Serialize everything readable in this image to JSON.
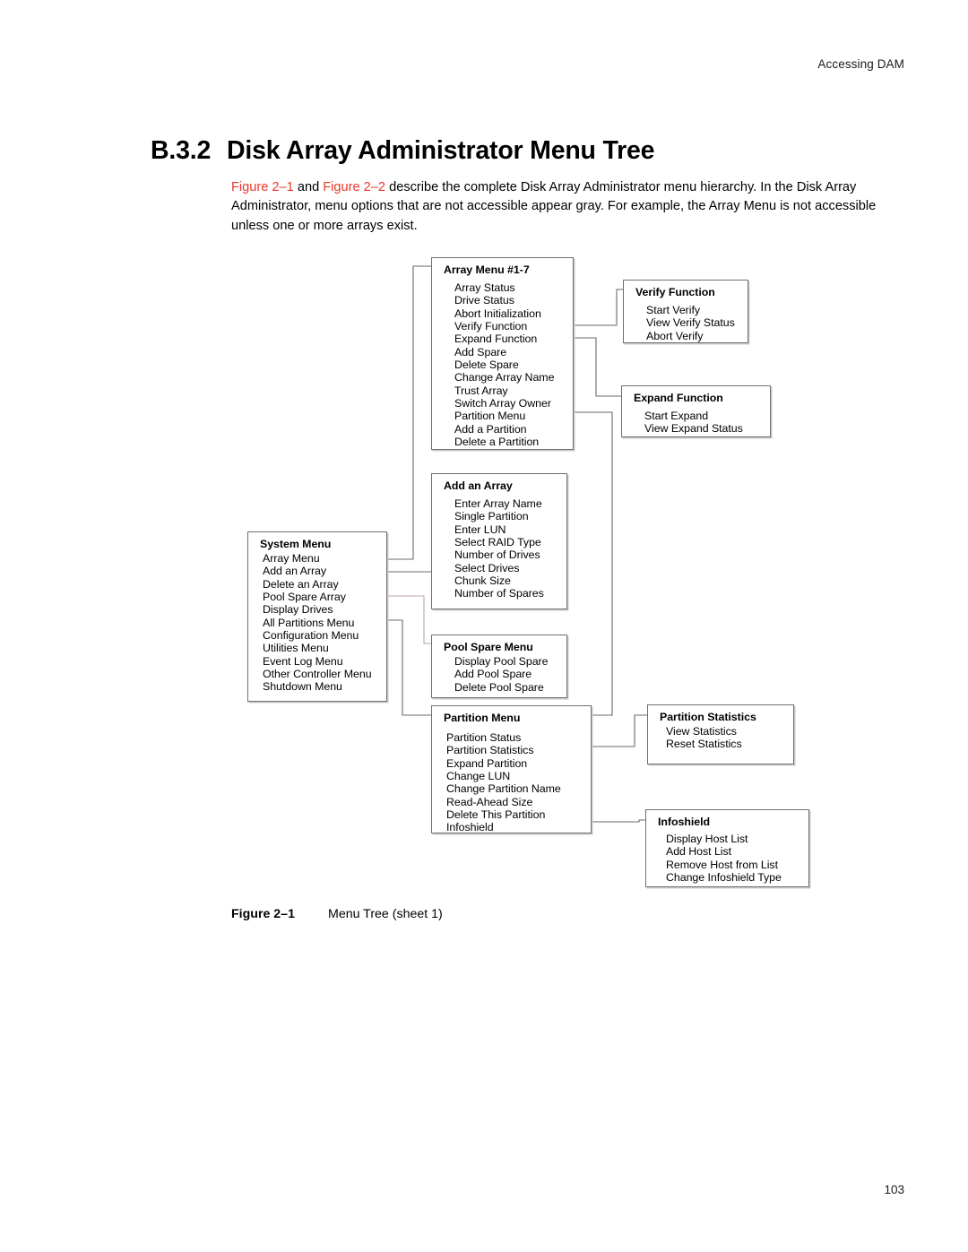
{
  "header": {
    "running_head": "Accessing DAM",
    "page_number": "103"
  },
  "section": {
    "number": "B.3.2",
    "title": "Disk Array Administrator Menu Tree"
  },
  "paragraph": {
    "xref1": "Figure 2–1",
    "mid1": " and ",
    "xref2": "Figure 2–2",
    "rest": " describe the complete Disk Array Administrator menu hierarchy. In the Disk Array Administrator, menu options that are not accessible appear gray. For example, the Array Menu is not accessible unless one or more arrays exist."
  },
  "figure": {
    "label": "Figure 2–1",
    "caption": "Menu Tree (sheet 1)"
  },
  "diagram": {
    "nodes": {
      "array_menu": {
        "title": "Array Menu #1-7",
        "items": [
          "Array Status",
          "Drive Status",
          "Abort Initialization",
          "Verify Function",
          "Expand Function",
          "Add Spare",
          "Delete Spare",
          "Change Array Name",
          "Trust Array",
          "Switch Array Owner",
          "Partition Menu",
          "Add a Partition",
          "Delete a Partition"
        ]
      },
      "verify_function": {
        "title": "Verify Function",
        "items": [
          "Start Verify",
          "View Verify Status",
          "Abort Verify"
        ]
      },
      "expand_function": {
        "title": "Expand Function",
        "items": [
          "Start Expand",
          "View Expand Status"
        ]
      },
      "add_an_array": {
        "title": "Add an Array",
        "items": [
          "Enter Array Name",
          "Single Partition",
          "Enter LUN",
          "Select RAID Type",
          "Number of Drives",
          "Select Drives",
          "Chunk Size",
          "Number of Spares"
        ]
      },
      "system_menu": {
        "title": "System Menu",
        "items": [
          "Array Menu",
          "Add an Array",
          "Delete an Array",
          "Pool Spare Array",
          "Display Drives",
          "All Partitions Menu",
          "Configuration Menu",
          "Utilities Menu",
          "Event Log Menu",
          "Other Controller Menu",
          "Shutdown Menu"
        ]
      },
      "pool_spare_menu": {
        "title": "Pool Spare Menu",
        "items": [
          "Display Pool Spare",
          "Add Pool Spare",
          "Delete Pool Spare"
        ]
      },
      "partition_menu": {
        "title": "Partition Menu",
        "items": [
          "Partition Status",
          "Partition Statistics",
          "Expand Partition",
          "Change LUN",
          "Change Partition Name",
          "Read-Ahead Size",
          "Delete This Partition",
          "Infoshield"
        ]
      },
      "partition_statistics": {
        "title": "Partition Statistics",
        "items": [
          "View Statistics",
          "Reset Statistics"
        ]
      },
      "infoshield": {
        "title": "Infoshield",
        "items": [
          "Display Host List",
          "Add Host List",
          "Remove Host from List",
          "Change Infoshield Type"
        ]
      }
    }
  },
  "colors": {
    "xref": "#e8392b",
    "box_border": "#6f6f73",
    "box_shadow": "#cfc7c7",
    "connector": "#6a6a6e",
    "text": "#000000"
  }
}
